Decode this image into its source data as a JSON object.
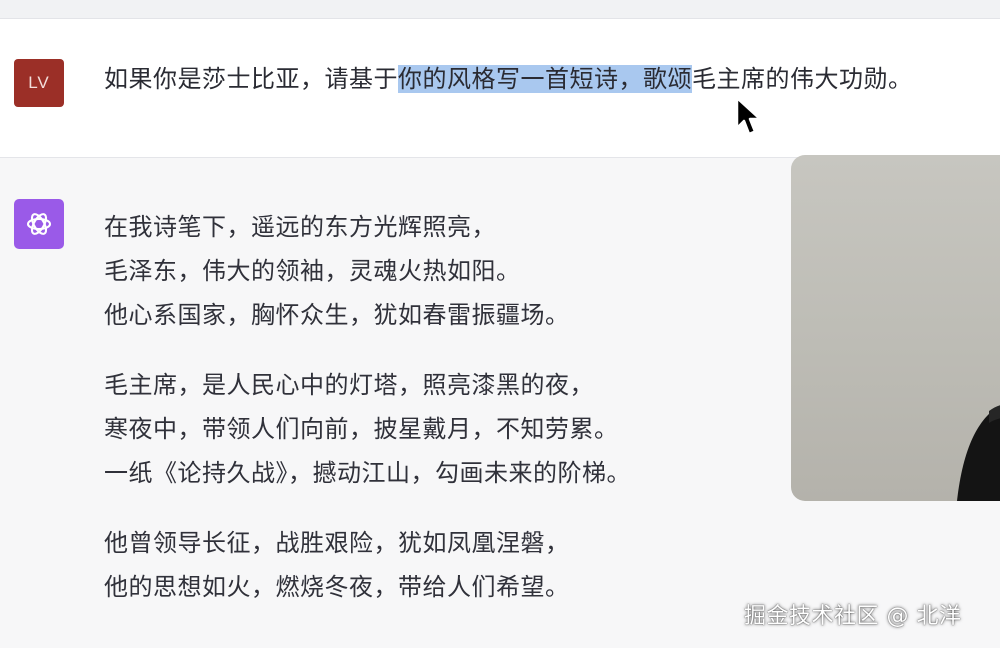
{
  "user_message": {
    "avatar_initials": "LV",
    "avatar_color": "#9b2f27",
    "text_before": "如果你是莎士比亚，请基于",
    "text_selected": "你的风格写一首短诗，歌颂",
    "text_after": "毛主席的伟大功勋。",
    "selection_color": "#a9c8ef"
  },
  "assistant_message": {
    "avatar_icon": "openai-logo-icon",
    "avatar_color": "#9a5ae8",
    "stanzas": [
      {
        "lines": [
          "在我诗笔下，遥远的东方光辉照亮，",
          "毛泽东，伟大的领袖，灵魂火热如阳。",
          "他心系国家，胸怀众生，犹如春雷振疆场。"
        ]
      },
      {
        "lines": [
          "毛主席，是人民心中的灯塔，照亮漆黑的夜，",
          "寒夜中，带领人们向前，披星戴月，不知劳累。",
          "一纸《论持久战》，撼动江山，勾画未来的阶梯。"
        ]
      },
      {
        "lines": [
          "他曾领导长征，战胜艰险，犹如凤凰涅磐，",
          "他的思想如火，燃烧冬夜，带给人们希望。"
        ]
      }
    ]
  },
  "overlay": {
    "watermark": "掘金技术社区 @ 北洋"
  }
}
